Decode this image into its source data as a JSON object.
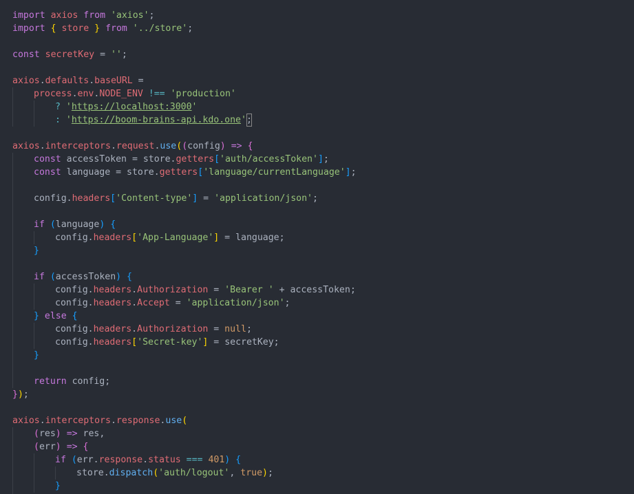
{
  "editor": {
    "language": "javascript",
    "colors": {
      "background": "#282c34",
      "keyword": "#c678dd",
      "string": "#98c379",
      "variable": "#e06c75",
      "function": "#61afef",
      "number": "#d19a66",
      "operator": "#56b6c2",
      "plain": "#abb2bf",
      "bracket_level_1": "#ffd700",
      "bracket_level_2": "#da70d6",
      "bracket_level_3": "#179fff",
      "indent_guide": "#3b4048"
    },
    "lines": [
      {
        "indent": 0,
        "tokens": []
      },
      {
        "indent": 0,
        "tokens": [
          {
            "t": "import",
            "c": "kw"
          },
          {
            "t": " ",
            "c": "plain"
          },
          {
            "t": "axios",
            "c": "var"
          },
          {
            "t": " ",
            "c": "plain"
          },
          {
            "t": "from",
            "c": "kw"
          },
          {
            "t": " ",
            "c": "plain"
          },
          {
            "t": "'axios'",
            "c": "str"
          },
          {
            "t": ";",
            "c": "plain"
          }
        ]
      },
      {
        "indent": 0,
        "tokens": [
          {
            "t": "import",
            "c": "kw"
          },
          {
            "t": " ",
            "c": "plain"
          },
          {
            "t": "{",
            "c": "brk1"
          },
          {
            "t": " ",
            "c": "plain"
          },
          {
            "t": "store",
            "c": "var"
          },
          {
            "t": " ",
            "c": "plain"
          },
          {
            "t": "}",
            "c": "brk1"
          },
          {
            "t": " ",
            "c": "plain"
          },
          {
            "t": "from",
            "c": "kw"
          },
          {
            "t": " ",
            "c": "plain"
          },
          {
            "t": "'../store'",
            "c": "str"
          },
          {
            "t": ";",
            "c": "plain"
          }
        ]
      },
      {
        "indent": 0,
        "tokens": []
      },
      {
        "indent": 0,
        "tokens": [
          {
            "t": "const",
            "c": "kw"
          },
          {
            "t": " ",
            "c": "plain"
          },
          {
            "t": "secretKey",
            "c": "var"
          },
          {
            "t": " = ",
            "c": "plain"
          },
          {
            "t": "''",
            "c": "str"
          },
          {
            "t": ";",
            "c": "plain"
          }
        ]
      },
      {
        "indent": 0,
        "tokens": []
      },
      {
        "indent": 0,
        "tokens": [
          {
            "t": "axios",
            "c": "var"
          },
          {
            "t": ".",
            "c": "plain"
          },
          {
            "t": "defaults",
            "c": "var"
          },
          {
            "t": ".",
            "c": "plain"
          },
          {
            "t": "baseURL",
            "c": "var"
          },
          {
            "t": " =",
            "c": "plain"
          }
        ]
      },
      {
        "indent": 1,
        "tokens": [
          {
            "t": "process",
            "c": "var"
          },
          {
            "t": ".",
            "c": "plain"
          },
          {
            "t": "env",
            "c": "var"
          },
          {
            "t": ".",
            "c": "plain"
          },
          {
            "t": "NODE_ENV",
            "c": "var"
          },
          {
            "t": " ",
            "c": "plain"
          },
          {
            "t": "!==",
            "c": "op"
          },
          {
            "t": " ",
            "c": "plain"
          },
          {
            "t": "'production'",
            "c": "str"
          }
        ]
      },
      {
        "indent": 2,
        "tokens": [
          {
            "t": "?",
            "c": "op"
          },
          {
            "t": " ",
            "c": "plain"
          },
          {
            "t": "'",
            "c": "str"
          },
          {
            "t": "https://localhost:3000",
            "c": "url"
          },
          {
            "t": "'",
            "c": "str"
          }
        ]
      },
      {
        "indent": 2,
        "tokens": [
          {
            "t": ":",
            "c": "op"
          },
          {
            "t": " ",
            "c": "plain"
          },
          {
            "t": "'",
            "c": "str"
          },
          {
            "t": "https://boom-brains-api.kdo.one",
            "c": "url"
          },
          {
            "t": "'",
            "c": "str"
          },
          {
            "t": ";",
            "c": "cursor"
          }
        ]
      },
      {
        "indent": 0,
        "tokens": []
      },
      {
        "indent": 0,
        "tokens": [
          {
            "t": "axios",
            "c": "var"
          },
          {
            "t": ".",
            "c": "plain"
          },
          {
            "t": "interceptors",
            "c": "var"
          },
          {
            "t": ".",
            "c": "plain"
          },
          {
            "t": "request",
            "c": "var"
          },
          {
            "t": ".",
            "c": "plain"
          },
          {
            "t": "use",
            "c": "fn"
          },
          {
            "t": "(",
            "c": "brk1"
          },
          {
            "t": "(",
            "c": "brk2"
          },
          {
            "t": "config",
            "c": "plain"
          },
          {
            "t": ")",
            "c": "brk2"
          },
          {
            "t": " ",
            "c": "plain"
          },
          {
            "t": "=>",
            "c": "kw"
          },
          {
            "t": " ",
            "c": "plain"
          },
          {
            "t": "{",
            "c": "brk2"
          }
        ]
      },
      {
        "indent": 1,
        "tokens": [
          {
            "t": "const",
            "c": "kw"
          },
          {
            "t": " ",
            "c": "plain"
          },
          {
            "t": "accessToken",
            "c": "plain"
          },
          {
            "t": " = ",
            "c": "plain"
          },
          {
            "t": "store",
            "c": "plain"
          },
          {
            "t": ".",
            "c": "plain"
          },
          {
            "t": "getters",
            "c": "var"
          },
          {
            "t": "[",
            "c": "brk3"
          },
          {
            "t": "'auth/accessToken'",
            "c": "str"
          },
          {
            "t": "]",
            "c": "brk3"
          },
          {
            "t": ";",
            "c": "plain"
          }
        ]
      },
      {
        "indent": 1,
        "tokens": [
          {
            "t": "const",
            "c": "kw"
          },
          {
            "t": " ",
            "c": "plain"
          },
          {
            "t": "language",
            "c": "plain"
          },
          {
            "t": " = ",
            "c": "plain"
          },
          {
            "t": "store",
            "c": "plain"
          },
          {
            "t": ".",
            "c": "plain"
          },
          {
            "t": "getters",
            "c": "var"
          },
          {
            "t": "[",
            "c": "brk3"
          },
          {
            "t": "'language/currentLanguage'",
            "c": "str"
          },
          {
            "t": "]",
            "c": "brk3"
          },
          {
            "t": ";",
            "c": "plain"
          }
        ]
      },
      {
        "indent": 1,
        "tokens": []
      },
      {
        "indent": 1,
        "tokens": [
          {
            "t": "config",
            "c": "plain"
          },
          {
            "t": ".",
            "c": "plain"
          },
          {
            "t": "headers",
            "c": "var"
          },
          {
            "t": "[",
            "c": "brk3"
          },
          {
            "t": "'Content-type'",
            "c": "str"
          },
          {
            "t": "]",
            "c": "brk3"
          },
          {
            "t": " = ",
            "c": "plain"
          },
          {
            "t": "'application/json'",
            "c": "str"
          },
          {
            "t": ";",
            "c": "plain"
          }
        ]
      },
      {
        "indent": 1,
        "tokens": []
      },
      {
        "indent": 1,
        "tokens": [
          {
            "t": "if",
            "c": "kw"
          },
          {
            "t": " ",
            "c": "plain"
          },
          {
            "t": "(",
            "c": "brk3"
          },
          {
            "t": "language",
            "c": "plain"
          },
          {
            "t": ")",
            "c": "brk3"
          },
          {
            "t": " ",
            "c": "plain"
          },
          {
            "t": "{",
            "c": "brk3"
          }
        ]
      },
      {
        "indent": 2,
        "tokens": [
          {
            "t": "config",
            "c": "plain"
          },
          {
            "t": ".",
            "c": "plain"
          },
          {
            "t": "headers",
            "c": "var"
          },
          {
            "t": "[",
            "c": "brk1"
          },
          {
            "t": "'App-Language'",
            "c": "str"
          },
          {
            "t": "]",
            "c": "brk1"
          },
          {
            "t": " = ",
            "c": "plain"
          },
          {
            "t": "language",
            "c": "plain"
          },
          {
            "t": ";",
            "c": "plain"
          }
        ]
      },
      {
        "indent": 1,
        "tokens": [
          {
            "t": "}",
            "c": "brk3"
          }
        ]
      },
      {
        "indent": 1,
        "tokens": []
      },
      {
        "indent": 1,
        "tokens": [
          {
            "t": "if",
            "c": "kw"
          },
          {
            "t": " ",
            "c": "plain"
          },
          {
            "t": "(",
            "c": "brk3"
          },
          {
            "t": "accessToken",
            "c": "plain"
          },
          {
            "t": ")",
            "c": "brk3"
          },
          {
            "t": " ",
            "c": "plain"
          },
          {
            "t": "{",
            "c": "brk3"
          }
        ]
      },
      {
        "indent": 2,
        "tokens": [
          {
            "t": "config",
            "c": "plain"
          },
          {
            "t": ".",
            "c": "plain"
          },
          {
            "t": "headers",
            "c": "var"
          },
          {
            "t": ".",
            "c": "plain"
          },
          {
            "t": "Authorization",
            "c": "var"
          },
          {
            "t": " = ",
            "c": "plain"
          },
          {
            "t": "'Bearer '",
            "c": "str"
          },
          {
            "t": " + ",
            "c": "plain"
          },
          {
            "t": "accessToken",
            "c": "plain"
          },
          {
            "t": ";",
            "c": "plain"
          }
        ]
      },
      {
        "indent": 2,
        "tokens": [
          {
            "t": "config",
            "c": "plain"
          },
          {
            "t": ".",
            "c": "plain"
          },
          {
            "t": "headers",
            "c": "var"
          },
          {
            "t": ".",
            "c": "plain"
          },
          {
            "t": "Accept",
            "c": "var"
          },
          {
            "t": " = ",
            "c": "plain"
          },
          {
            "t": "'application/json'",
            "c": "str"
          },
          {
            "t": ";",
            "c": "plain"
          }
        ]
      },
      {
        "indent": 1,
        "tokens": [
          {
            "t": "}",
            "c": "brk3"
          },
          {
            "t": " ",
            "c": "plain"
          },
          {
            "t": "else",
            "c": "kw"
          },
          {
            "t": " ",
            "c": "plain"
          },
          {
            "t": "{",
            "c": "brk3"
          }
        ]
      },
      {
        "indent": 2,
        "tokens": [
          {
            "t": "config",
            "c": "plain"
          },
          {
            "t": ".",
            "c": "plain"
          },
          {
            "t": "headers",
            "c": "var"
          },
          {
            "t": ".",
            "c": "plain"
          },
          {
            "t": "Authorization",
            "c": "var"
          },
          {
            "t": " = ",
            "c": "plain"
          },
          {
            "t": "null",
            "c": "lit"
          },
          {
            "t": ";",
            "c": "plain"
          }
        ]
      },
      {
        "indent": 2,
        "tokens": [
          {
            "t": "config",
            "c": "plain"
          },
          {
            "t": ".",
            "c": "plain"
          },
          {
            "t": "headers",
            "c": "var"
          },
          {
            "t": "[",
            "c": "brk1"
          },
          {
            "t": "'Secret-key'",
            "c": "str"
          },
          {
            "t": "]",
            "c": "brk1"
          },
          {
            "t": " = ",
            "c": "plain"
          },
          {
            "t": "secretKey",
            "c": "plain"
          },
          {
            "t": ";",
            "c": "plain"
          }
        ]
      },
      {
        "indent": 1,
        "tokens": [
          {
            "t": "}",
            "c": "brk3"
          }
        ]
      },
      {
        "indent": 1,
        "tokens": []
      },
      {
        "indent": 1,
        "tokens": [
          {
            "t": "return",
            "c": "kw"
          },
          {
            "t": " ",
            "c": "plain"
          },
          {
            "t": "config",
            "c": "plain"
          },
          {
            "t": ";",
            "c": "plain"
          }
        ]
      },
      {
        "indent": 0,
        "tokens": [
          {
            "t": "}",
            "c": "brk2"
          },
          {
            "t": ")",
            "c": "brk1"
          },
          {
            "t": ";",
            "c": "plain"
          }
        ]
      },
      {
        "indent": 0,
        "tokens": []
      },
      {
        "indent": 0,
        "tokens": [
          {
            "t": "axios",
            "c": "var"
          },
          {
            "t": ".",
            "c": "plain"
          },
          {
            "t": "interceptors",
            "c": "var"
          },
          {
            "t": ".",
            "c": "plain"
          },
          {
            "t": "response",
            "c": "var"
          },
          {
            "t": ".",
            "c": "plain"
          },
          {
            "t": "use",
            "c": "fn"
          },
          {
            "t": "(",
            "c": "brk1"
          }
        ]
      },
      {
        "indent": 1,
        "tokens": [
          {
            "t": "(",
            "c": "brk2"
          },
          {
            "t": "res",
            "c": "plain"
          },
          {
            "t": ")",
            "c": "brk2"
          },
          {
            "t": " ",
            "c": "plain"
          },
          {
            "t": "=>",
            "c": "kw"
          },
          {
            "t": " ",
            "c": "plain"
          },
          {
            "t": "res",
            "c": "plain"
          },
          {
            "t": ",",
            "c": "plain"
          }
        ]
      },
      {
        "indent": 1,
        "tokens": [
          {
            "t": "(",
            "c": "brk2"
          },
          {
            "t": "err",
            "c": "plain"
          },
          {
            "t": ")",
            "c": "brk2"
          },
          {
            "t": " ",
            "c": "plain"
          },
          {
            "t": "=>",
            "c": "kw"
          },
          {
            "t": " ",
            "c": "plain"
          },
          {
            "t": "{",
            "c": "brk2"
          }
        ]
      },
      {
        "indent": 2,
        "tokens": [
          {
            "t": "if",
            "c": "kw"
          },
          {
            "t": " ",
            "c": "plain"
          },
          {
            "t": "(",
            "c": "brk3"
          },
          {
            "t": "err",
            "c": "plain"
          },
          {
            "t": ".",
            "c": "plain"
          },
          {
            "t": "response",
            "c": "var"
          },
          {
            "t": ".",
            "c": "plain"
          },
          {
            "t": "status",
            "c": "var"
          },
          {
            "t": " ",
            "c": "plain"
          },
          {
            "t": "===",
            "c": "op"
          },
          {
            "t": " ",
            "c": "plain"
          },
          {
            "t": "401",
            "c": "num"
          },
          {
            "t": ")",
            "c": "brk3"
          },
          {
            "t": " ",
            "c": "plain"
          },
          {
            "t": "{",
            "c": "brk3"
          }
        ]
      },
      {
        "indent": 3,
        "tokens": [
          {
            "t": "store",
            "c": "plain"
          },
          {
            "t": ".",
            "c": "plain"
          },
          {
            "t": "dispatch",
            "c": "fn"
          },
          {
            "t": "(",
            "c": "brk1"
          },
          {
            "t": "'auth/logout'",
            "c": "str"
          },
          {
            "t": ", ",
            "c": "plain"
          },
          {
            "t": "true",
            "c": "lit"
          },
          {
            "t": ")",
            "c": "brk1"
          },
          {
            "t": ";",
            "c": "plain"
          }
        ]
      },
      {
        "indent": 2,
        "tokens": [
          {
            "t": "}",
            "c": "brk3"
          }
        ]
      },
      {
        "indent": 1,
        "tokens": [
          {
            "t": "}",
            "c": "brk2"
          }
        ]
      }
    ]
  }
}
